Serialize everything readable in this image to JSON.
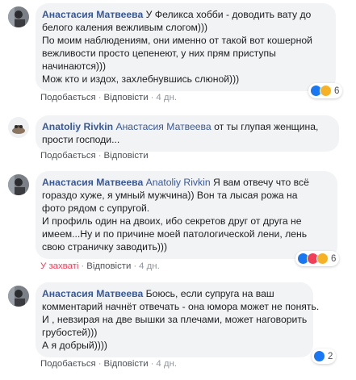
{
  "comments": [
    {
      "author": "Анастасия Матвеева",
      "lines": [
        "У Феликса хобби - доводить вату до",
        "белого каления вежливым слогом)))",
        "По моим наблюдениям, они именно от такой вот кошерной",
        "вежливости просто цепенеют, у них прям приступы",
        "начинаются)))",
        "Мож кто и издох, захлебнувшись слюной)))"
      ],
      "actions": {
        "like": "Подобається",
        "reply": "Відповісти",
        "time": "4 дн."
      },
      "reactions": {
        "icons": [
          "like-icon",
          "haha-icon"
        ],
        "count": "6"
      }
    },
    {
      "author": "Anatoliy Rivkin",
      "mention": "Анастасия Матвеева",
      "lines": [
        "от ты глупая женщина,",
        "прости господи..."
      ],
      "actions": {
        "like": "Подобається",
        "reply": "Відповісти"
      }
    },
    {
      "author": "Анастасия Матвеева",
      "mention": "Anatoliy Rivkin",
      "lines": [
        "Я вам отвечу что всё",
        "гораздо хуже, я умный мужчина)) Вон та лысая рожа на",
        "фото рядом с супругой.",
        "И профиль один на двоих, ибо секретов друг от друга не",
        "имеем...Ну и по причине моей патологической лени, лень",
        "свою страничку заводить)))"
      ],
      "actions": {
        "like": "У захваті",
        "reply": "Відповісти",
        "time": "4 дн."
      },
      "reactions": {
        "icons": [
          "like-icon",
          "love-icon",
          "haha-icon"
        ],
        "count": "6"
      }
    },
    {
      "author": "Анастасия Матвеева",
      "lines": [
        "Боюсь, если супруга на ваш",
        "комментарий начнёт отвечать - она юмора может не понять.",
        "И , невзирая на две вышки за плечами, может наговорить",
        "грубостей)))",
        "А я добрый))))"
      ],
      "actions": {
        "like": "Подобається",
        "reply": "Відповісти",
        "time": "4 дн."
      },
      "reactions": {
        "icons": [
          "like-icon"
        ],
        "count": "2"
      }
    }
  ],
  "colors": {
    "name": "#385898",
    "bubble": "#f2f3f5",
    "love_text": "#f33e58",
    "like": "#1877f2",
    "haha": "#f7b125",
    "love": "#f33e58"
  }
}
